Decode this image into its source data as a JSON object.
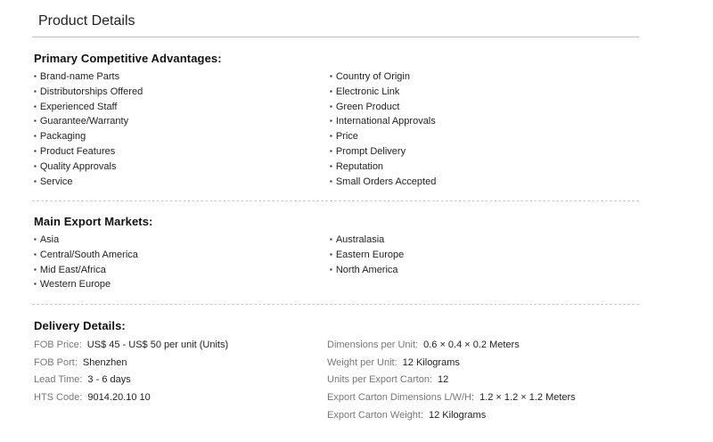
{
  "title": "Product Details",
  "advantages": {
    "heading": "Primary Competitive Advantages:",
    "left": [
      "Brand-name Parts",
      "Distributorships Offered",
      "Experienced Staff",
      "Guarantee/Warranty",
      "Packaging",
      "Product Features",
      "Quality Approvals",
      "Service"
    ],
    "right": [
      "Country of Origin",
      "Electronic Link",
      "Green Product",
      "International Approvals",
      "Price",
      "Prompt Delivery",
      "Reputation",
      "Small Orders Accepted"
    ]
  },
  "markets": {
    "heading": "Main Export Markets:",
    "left": [
      "Asia",
      "Central/South America",
      "Mid East/Africa",
      "Western Europe"
    ],
    "right": [
      "Australasia",
      "Eastern Europe",
      "North America"
    ]
  },
  "delivery": {
    "heading": "Delivery Details:",
    "left": [
      {
        "label": "FOB Price:",
        "value": "US$ 45 - US$ 50 per unit (Units)"
      },
      {
        "label": "FOB Port:",
        "value": "Shenzhen"
      },
      {
        "label": "Lead Time:",
        "value": "3 - 6 days"
      },
      {
        "label": "HTS Code:",
        "value": "9014.20.10 10"
      }
    ],
    "right": [
      {
        "label": "Dimensions per Unit:",
        "value": "0.6 × 0.4 × 0.2 Meters"
      },
      {
        "label": "Weight per Unit:",
        "value": "12 Kilograms"
      },
      {
        "label": "Units per Export Carton:",
        "value": "12"
      },
      {
        "label": "Export Carton Dimensions L/W/H:",
        "value": "1.2 × 1.2 × 1.2 Meters"
      },
      {
        "label": "Export Carton Weight:",
        "value": "12 Kilograms"
      }
    ]
  }
}
